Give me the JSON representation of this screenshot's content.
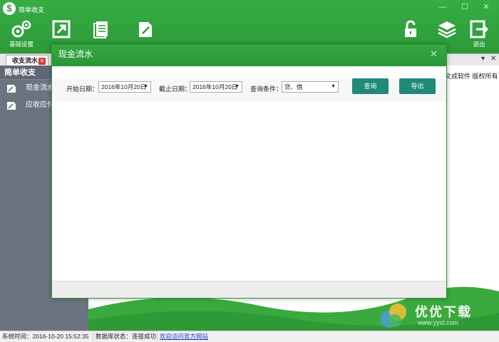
{
  "app": {
    "title": "简单收支",
    "logo_glyph": "$"
  },
  "window_controls": {
    "minimize": "—",
    "maximize": "☐",
    "close": "✕"
  },
  "toolbar": {
    "left": [
      {
        "label": "基础设置",
        "icon": "gears-icon"
      },
      {
        "label": "",
        "icon": "export-icon"
      },
      {
        "label": "",
        "icon": "document-icon"
      },
      {
        "label": "",
        "icon": "edit-document-icon"
      }
    ],
    "right": [
      {
        "label": "",
        "icon": "lock-icon"
      },
      {
        "label": "",
        "icon": "layers-icon"
      },
      {
        "label": "退出",
        "icon": "exit-icon"
      }
    ]
  },
  "tabs": [
    {
      "label": "收支流水",
      "close": "✕"
    }
  ],
  "tab_strip_controls": {
    "menu": "▾",
    "close": "✕"
  },
  "sidebar": {
    "header": "简单收支",
    "items": [
      {
        "label": "现金流水",
        "icon": "cash-flow-icon"
      },
      {
        "label": "应收应付",
        "icon": "receivable-icon"
      }
    ]
  },
  "main_banner": "文成软件  版权所有",
  "dialog": {
    "title": "现金流水",
    "close": "✕",
    "filters": {
      "start_date_label": "开始日期：",
      "start_date_value": "2016年10月20日",
      "end_date_label": "截止日期：",
      "end_date_value": "2016年10月20日",
      "condition_label": "查询条件：",
      "condition_value": "贷、借"
    },
    "query_button": "查询",
    "export_button": "导出"
  },
  "status_bar": {
    "system_time": "系统时间：2016-10-20 15:52:35",
    "db_status": "数据库状态：连接成功",
    "website_link": "欢迎访问官方网站"
  },
  "watermark": {
    "text": "优优下载",
    "url": "www.yyxt.com"
  },
  "colors": {
    "brand_green": "#2c9a38",
    "button_teal": "#1f8a75",
    "sidebar": "#6b7380"
  }
}
